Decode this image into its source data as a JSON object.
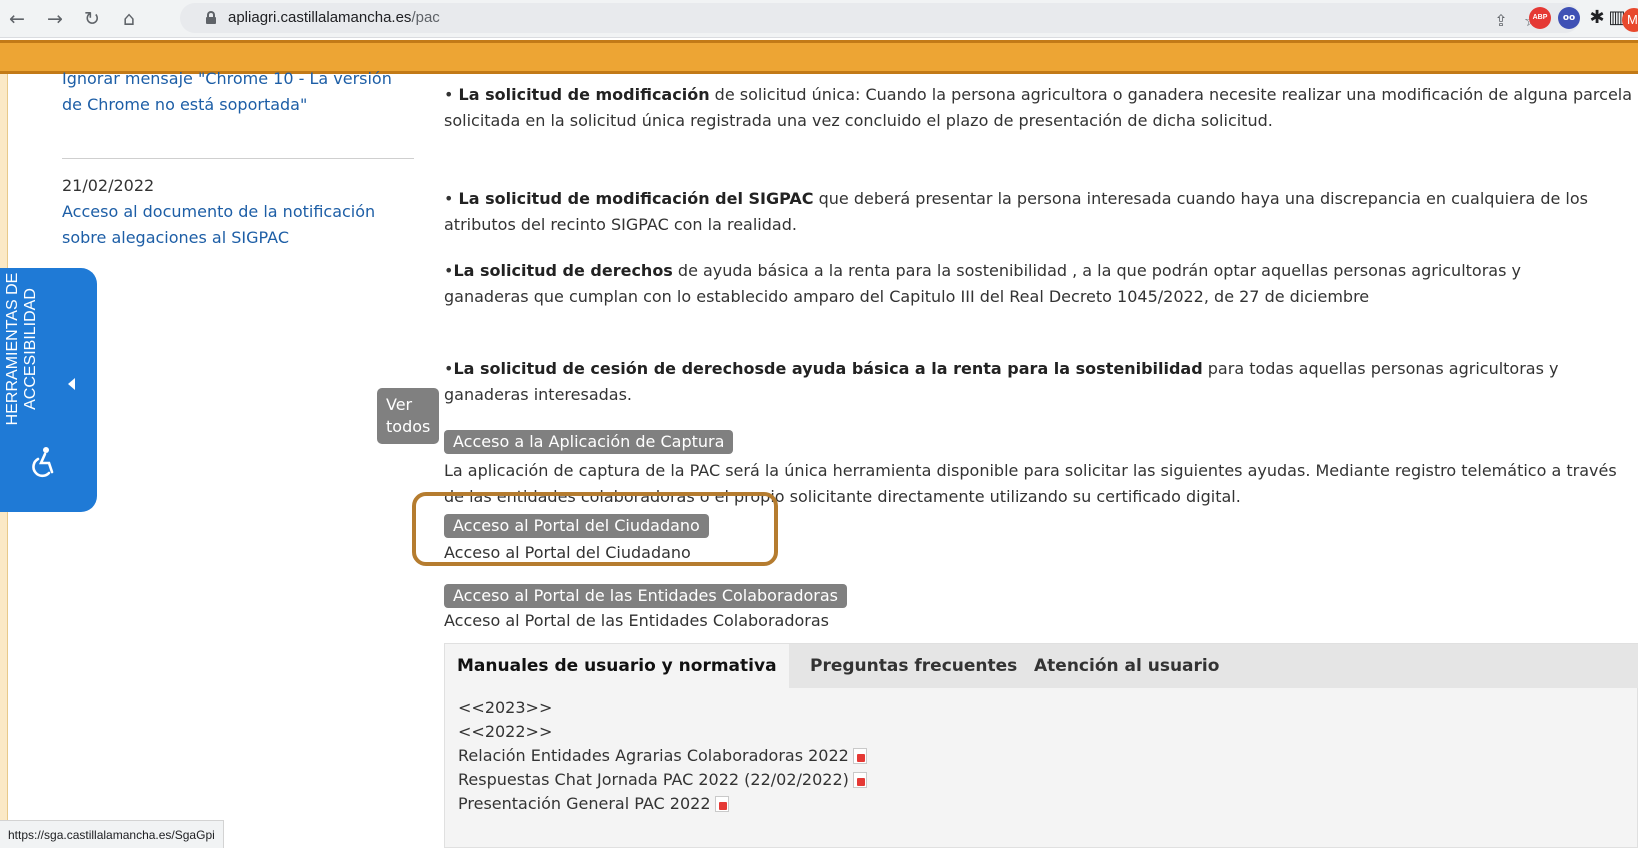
{
  "browser": {
    "url_host": "apliagri.castillalamancha.es",
    "url_path": "/pac",
    "profile_initial": "M",
    "ext_abp_label": "ABP",
    "ext_blue_label": "oo"
  },
  "sidebar": {
    "news1_text": "Ignorar mensaje \"Chrome 10 - La versión de Chrome no está soportada\"",
    "news2_date": "21/02/2022",
    "news2_text": "Acceso al documento de la notificación sobre alegaciones al SIGPAC",
    "ver_todos_label": "Ver todos"
  },
  "accessibility": {
    "label_line1": "HERRAMIENTAS DE",
    "label_line2": "ACCESIBILIDAD"
  },
  "main": {
    "p1_bullet": "• ",
    "p1_bold": "La solicitud de modificación",
    "p1_rest": " de solicitud única: Cuando la persona agricultora o ganadera necesite realizar una modificación de alguna parcela solicitada en la solicitud única registrada una vez concluido el plazo de presentación de dicha solicitud.",
    "p2_bullet": "• ",
    "p2_bold": "La solicitud de modificación del SIGPAC",
    "p2_rest": " que deberá presentar la persona interesada cuando haya una discrepancia en cualquiera de los atributos del recinto SIGPAC con la realidad.",
    "p3_bullet": "•",
    "p3_bold": "La solicitud de derechos",
    "p3_rest": " de ayuda básica a la renta para la sostenibilidad , a la que podrán optar aquellas personas agricultoras y ganaderas que cumplan con lo establecido amparo del Capitulo III del Real Decreto 1045/2022, de 27 de diciembre",
    "p4_bullet": "•",
    "p4_bold": "La solicitud de cesión de derechosde ayuda básica a la renta para la sostenibilidad",
    "p4_rest": " para todas aquellas personas agricultoras y ganaderas interesadas.",
    "btn_captura": "Acceso a la Aplicación de Captura",
    "captura_desc": "La aplicación de captura de la PAC será la única herramienta disponible para solicitar las siguientes ayudas. Mediante registro telemático a través de las entidades colaboradoras o el propio solicitante directamente utilizando su certificado digital.",
    "btn_ciudadano": "Acceso al Portal del Ciudadano",
    "ciudadano_desc": "Acceso al Portal del Ciudadano",
    "btn_entidades": "Acceso al Portal de las Entidades Colaboradoras",
    "entidades_desc": "Acceso al Portal de las Entidades Colaboradoras"
  },
  "tabs": {
    "items": [
      "Manuales de usuario y normativa",
      "Preguntas frecuentes",
      "Atención al usuario"
    ],
    "list": [
      "<<2023>>",
      "<<2022>>",
      "Relación Entidades Agrarias Colaboradoras 2022",
      "Respuestas Chat Jornada PAC 2022 (22/02/2022)",
      "Presentación General PAC 2022"
    ]
  },
  "status_bar": {
    "url": "https://sga.castillalamancha.es/SgaGpi"
  }
}
